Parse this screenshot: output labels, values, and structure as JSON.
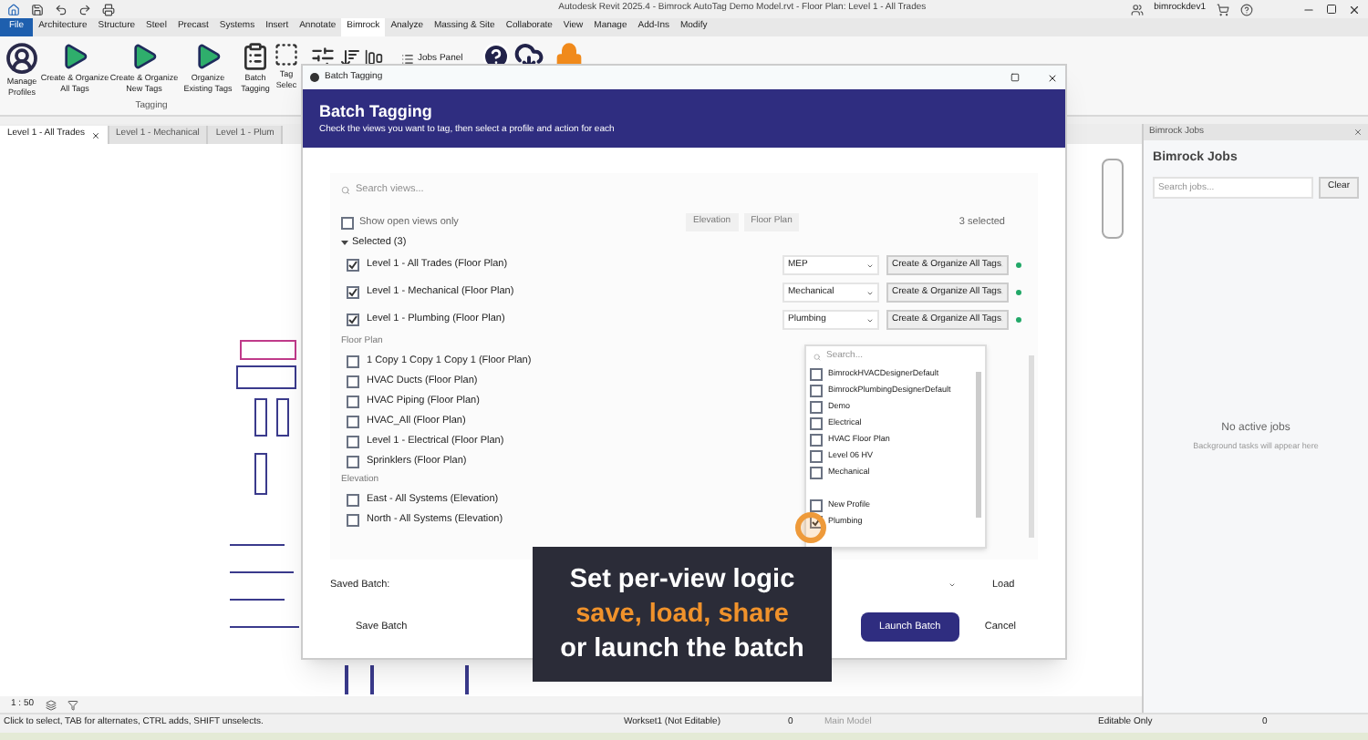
{
  "title_bar": {
    "title": "Autodesk Revit 2025.4 - Bimrock AutoTag Demo Model.rvt - Floor Plan: Level 1 - All Trades",
    "user": "bimrockdev1"
  },
  "ribbon_tabs": [
    {
      "label": "File",
      "kind": "file",
      "selected": false
    },
    {
      "label": "Architecture",
      "kind": "tab",
      "selected": false
    },
    {
      "label": "Structure",
      "kind": "tab",
      "selected": false
    },
    {
      "label": "Steel",
      "kind": "tab",
      "selected": false
    },
    {
      "label": "Precast",
      "kind": "tab",
      "selected": false
    },
    {
      "label": "Systems",
      "kind": "tab",
      "selected": false
    },
    {
      "label": "Insert",
      "kind": "tab",
      "selected": false
    },
    {
      "label": "Annotate",
      "kind": "tab",
      "selected": false
    },
    {
      "label": "Bimrock",
      "kind": "tab",
      "selected": true
    },
    {
      "label": "Analyze",
      "kind": "tab",
      "selected": false
    },
    {
      "label": "Massing & Site",
      "kind": "tab",
      "selected": false
    },
    {
      "label": "Collaborate",
      "kind": "tab",
      "selected": false
    },
    {
      "label": "View",
      "kind": "tab",
      "selected": false
    },
    {
      "label": "Manage",
      "kind": "tab",
      "selected": false
    },
    {
      "label": "Add-Ins",
      "kind": "tab",
      "selected": false
    },
    {
      "label": "Modify",
      "kind": "tab",
      "selected": false
    }
  ],
  "ribbon_buttons": [
    {
      "label": "Manage Profiles",
      "kind": "profile"
    },
    {
      "label": "Create & Organize All Tags",
      "kind": "play"
    },
    {
      "label": "Create & Organize New Tags",
      "kind": "play"
    },
    {
      "label": "Organize Existing Tags",
      "kind": "play"
    },
    {
      "label": "Batch Tagging",
      "kind": "batch"
    },
    {
      "label": "Tag Selec",
      "kind": "select"
    }
  ],
  "ribbon_panel_label": "Tagging",
  "jobs_panel_button": "Jobs Panel",
  "view_tabs": [
    {
      "label": "Level 1 - All Trades",
      "selected": true
    },
    {
      "label": "Level 1 - Mechanical",
      "selected": false
    },
    {
      "label": "Level 1 - Plum",
      "selected": false
    }
  ],
  "dialog": {
    "window_title": "Batch Tagging",
    "header_title": "Batch Tagging",
    "subtitle": "Check the views you want to tag, then select a profile and action for each",
    "search_placeholder": "Search views...",
    "show_open_only": {
      "label": "Show open views only",
      "checked": false
    },
    "filters": [
      {
        "label": "Elevation",
        "selected": false
      },
      {
        "label": "Floor Plan",
        "selected": false
      }
    ],
    "selected_count": "3 selected",
    "selected_group": {
      "label": "Selected (3)",
      "expanded": true,
      "items": [
        {
          "label": "Level 1 - All Trades (Floor Plan)",
          "checked": true,
          "profile": "MEP",
          "action": "Create & Organize All Tags",
          "color": "#22a868"
        },
        {
          "label": "Level 1 - Mechanical (Floor Plan)",
          "checked": true,
          "profile": "Mechanical",
          "action": "Create & Organize All Tags",
          "color": "#22a868"
        },
        {
          "label": "Level 1 - Plumbing (Floor Plan)",
          "checked": true,
          "profile": "Plumbing",
          "action": "Create & Organize All Tags",
          "color": "#22a868"
        }
      ]
    },
    "groups": [
      {
        "label": "Floor Plan",
        "items": [
          {
            "label": "1 Copy 1 Copy 1 Copy 1 (Floor Plan)",
            "checked": false
          },
          {
            "label": "HVAC Ducts (Floor Plan)",
            "checked": false
          },
          {
            "label": "HVAC Piping (Floor Plan)",
            "checked": false
          },
          {
            "label": "HVAC_All (Floor Plan)",
            "checked": false
          },
          {
            "label": "Level 1 - Electrical (Floor Plan)",
            "checked": false
          },
          {
            "label": "Sprinklers (Floor Plan)",
            "checked": false
          }
        ]
      },
      {
        "label": "Elevation",
        "items": [
          {
            "label": "East - All Systems (Elevation)",
            "checked": false
          },
          {
            "label": "North - All Systems (Elevation)",
            "checked": false
          }
        ]
      }
    ],
    "profile_dropdown": {
      "placeholder": "Search...",
      "options": [
        {
          "label": "BimrockHVACDesignerDefault",
          "checked": false
        },
        {
          "label": "BimrockPlumbingDesignerDefault",
          "checked": false
        },
        {
          "label": "Demo",
          "checked": false
        },
        {
          "label": "Electrical",
          "checked": false
        },
        {
          "label": "HVAC Floor Plan",
          "checked": false
        },
        {
          "label": "Level 06 HV",
          "checked": false
        },
        {
          "label": "Mechanical",
          "checked": false
        },
        {
          "label": "New Profile",
          "checked": false
        },
        {
          "label": "Plumbing",
          "checked": true
        }
      ]
    },
    "saved_batch_label": "Saved Batch:",
    "load_button": "Load",
    "save_button": "Save Batch",
    "launch_button": "Launch Batch",
    "cancel_button": "Cancel"
  },
  "jobs_panel": {
    "tab_label": "Bimrock Jobs",
    "title": "Bimrock Jobs",
    "search_placeholder": "Search jobs...",
    "clear_button": "Clear",
    "empty_title": "No active jobs",
    "empty_hint": "Background tasks will appear here"
  },
  "caption": {
    "line_1": "Set per-view logic",
    "line_2": "save, load, share",
    "line_3": "or launch the batch"
  },
  "view_control": {
    "scale": "1 : 50"
  },
  "status_bar": {
    "hint": "Click to select, TAB for alternates, CTRL adds, SHIFT unselects.",
    "workset": "Workset1 (Not Editable)",
    "count": "0",
    "model": "Main Model",
    "editable_only": "Editable Only",
    "filter_count": "0"
  }
}
